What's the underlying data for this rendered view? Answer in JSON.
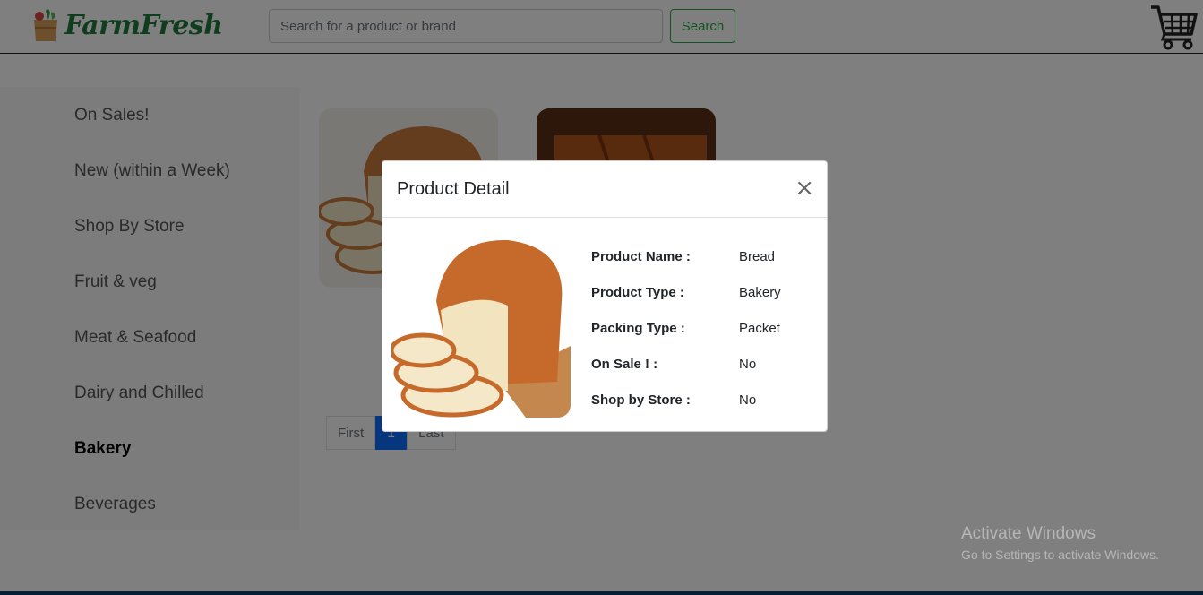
{
  "header": {
    "logo_text": "FarmFresh",
    "search_placeholder": "Search for a product or brand",
    "search_button": "Search"
  },
  "sidebar": {
    "items": [
      {
        "label": "On Sales!"
      },
      {
        "label": "New (within a Week)"
      },
      {
        "label": "Shop By Store"
      },
      {
        "label": "Fruit & veg"
      },
      {
        "label": "Meat & Seafood"
      },
      {
        "label": "Dairy and Chilled"
      },
      {
        "label": "Bakery"
      },
      {
        "label": "Beverages"
      }
    ],
    "active": "Bakery"
  },
  "pagination": {
    "first": "First",
    "current": "1",
    "last": "Last"
  },
  "modal": {
    "title": "Product Detail",
    "close": "×",
    "fields": [
      {
        "label": "Product Name :",
        "value": "Bread"
      },
      {
        "label": "Product Type :",
        "value": "Bakery"
      },
      {
        "label": "Packing Type :",
        "value": "Packet"
      },
      {
        "label": "On Sale ! :",
        "value": "No"
      },
      {
        "label": "Shop by Store :",
        "value": "No"
      }
    ]
  },
  "watermark": {
    "line1": "Activate Windows",
    "line2": "Go to Settings to activate Windows."
  },
  "colors": {
    "brand_green": "#1e7a3c",
    "search_green": "#28a745",
    "page_active": "#0d6efd"
  }
}
